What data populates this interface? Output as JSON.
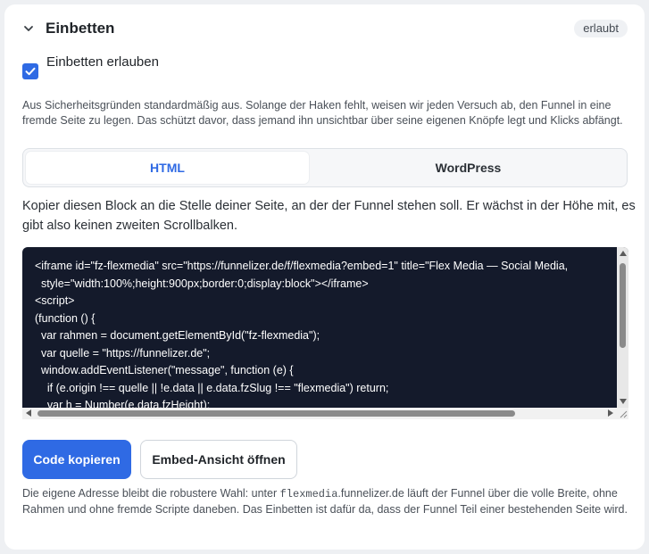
{
  "section": {
    "title": "Einbetten",
    "badge": "erlaubt",
    "collapse_icon": "chevron-down-icon"
  },
  "embed_toggle": {
    "label": "Einbetten erlauben",
    "checked": true
  },
  "security_note": "Aus Sicherheitsgründen standardmäßig aus. Solange der Haken fehlt, weisen wir jeden Versuch ab, den Funnel in eine fremde Seite zu legen. Das schützt davor, dass jemand ihn unsichtbar über seine eigenen Knöpfe legt und Klicks abfängt.",
  "tabs": [
    {
      "label": "HTML",
      "active": true
    },
    {
      "label": "WordPress",
      "active": false
    }
  ],
  "intro": "Kopier diesen Block an die Stelle deiner Seite, an der der Funnel stehen soll. Er wächst in der Höhe mit, es gibt also keinen zweiten Scrollbalken.",
  "code_lines": [
    "<iframe id=\"fz-flexmedia\" src=\"https://funnelizer.de/f/flexmedia?embed=1\" title=\"Flex Media — Social Media,",
    "  style=\"width:100%;height:900px;border:0;display:block\"></iframe>",
    "<script>",
    "(function () {",
    "  var rahmen = document.getElementById(\"fz-flexmedia\");",
    "  var quelle = \"https://funnelizer.de\";",
    "  window.addEventListener(\"message\", function (e) {",
    "    if (e.origin !== quelle || !e.data || e.data.fzSlug !== \"flexmedia\") return;",
    "    var h = Number(e.data.fzHeight);"
  ],
  "buttons": {
    "copy": "Code kopieren",
    "open": "Embed-Ansicht öffnen"
  },
  "footer": {
    "prefix": "Die eigene Adresse bleibt die robustere Wahl: unter ",
    "domain_mono": "flexmedia",
    "domain_rest": ".funnelizer.de",
    "suffix": " läuft der Funnel über die volle Breite, ohne Rahmen und ohne fremde Scripte daneben. Das Einbetten ist dafür da, dass der Funnel Teil einer bestehenden Seite wird."
  },
  "colors": {
    "accent": "#2f6ae4",
    "code_bg": "#141a2b"
  }
}
